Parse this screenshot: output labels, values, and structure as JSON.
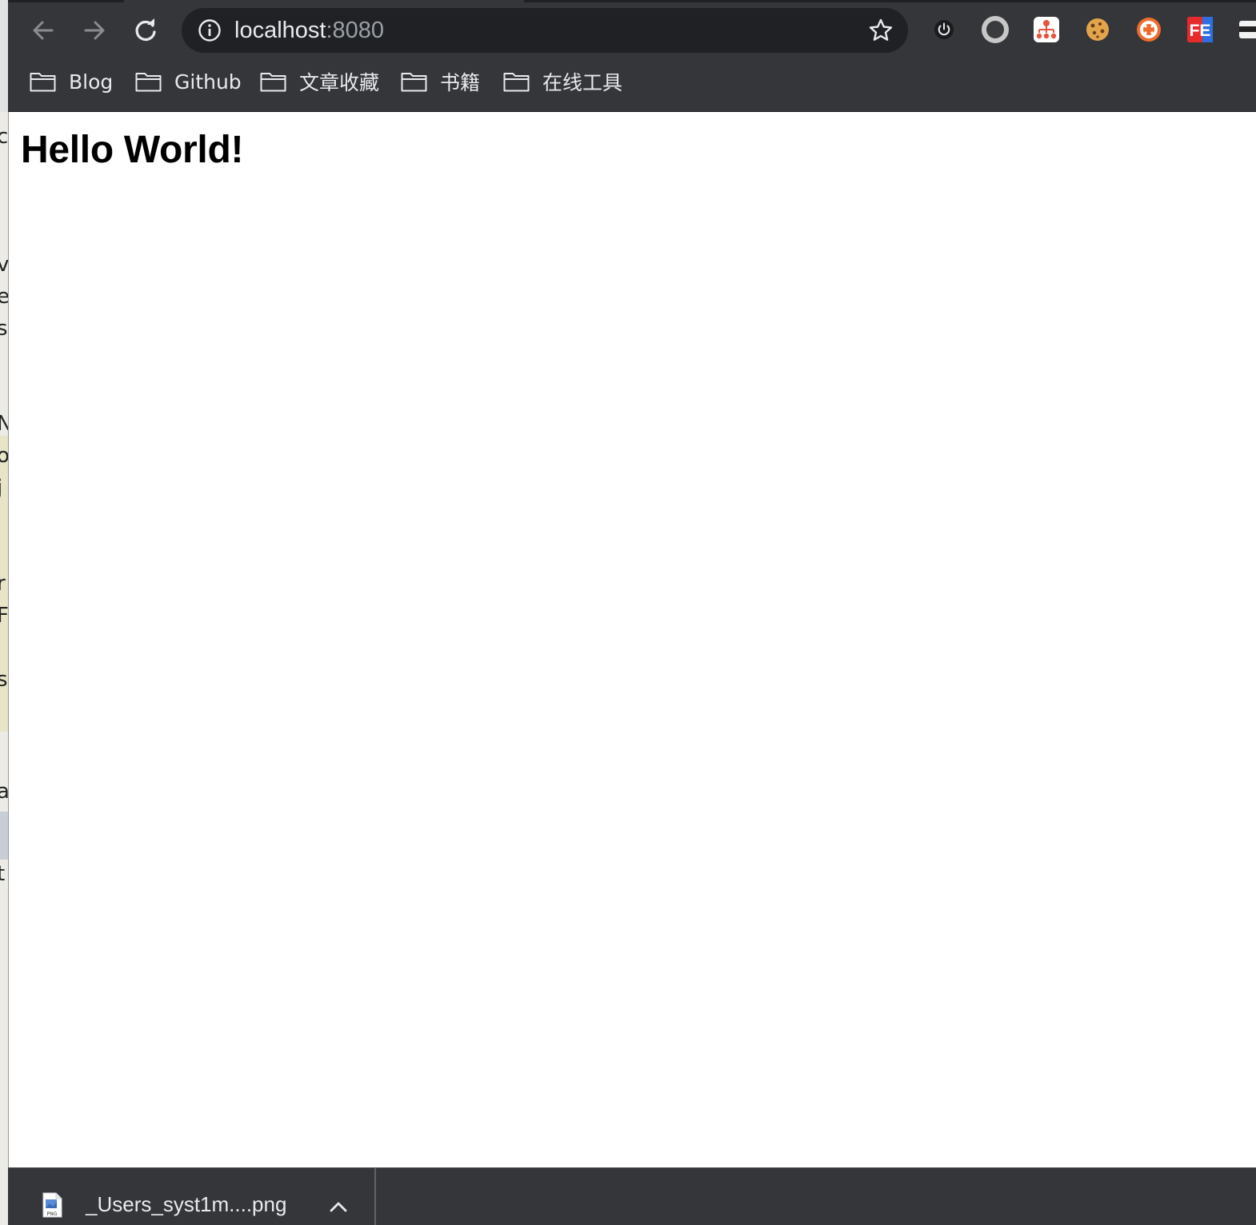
{
  "browser": {
    "address_bar": {
      "host": "localhost",
      "port": ":8080"
    },
    "toolbar_icons": [
      "back-arrow-icon",
      "forward-arrow-icon",
      "reload-icon",
      "site-info-icon",
      "bookmark-star-icon"
    ],
    "extensions": [
      {
        "name": "power-extension-icon"
      },
      {
        "name": "circle-extension-icon"
      },
      {
        "name": "sitemap-extension-icon"
      },
      {
        "name": "cookie-extension-icon"
      },
      {
        "name": "lifebuoy-extension-icon"
      },
      {
        "name": "fe-extension-icon",
        "label": "FE"
      },
      {
        "name": "mask-extension-icon"
      }
    ],
    "bookmarks": [
      {
        "label": "Blog"
      },
      {
        "label": "Github"
      },
      {
        "label": "文章收藏"
      },
      {
        "label": "书籍"
      },
      {
        "label": "在线工具"
      }
    ]
  },
  "page": {
    "heading": "Hello World!"
  },
  "left_window": {
    "visible_characters": [
      "c",
      "v",
      "e",
      "s",
      "N",
      "o",
      "j",
      "r",
      "F",
      "s",
      "a",
      "t"
    ]
  },
  "downloads": {
    "items": [
      {
        "filename": "_Users_syst1m....png",
        "file_type_label": "PNG"
      }
    ]
  },
  "colors": {
    "toolbar_bg": "#35363a",
    "omnibox_bg": "#202124",
    "text_light": "#e8eaed",
    "port_gray": "#9aa0a6"
  }
}
